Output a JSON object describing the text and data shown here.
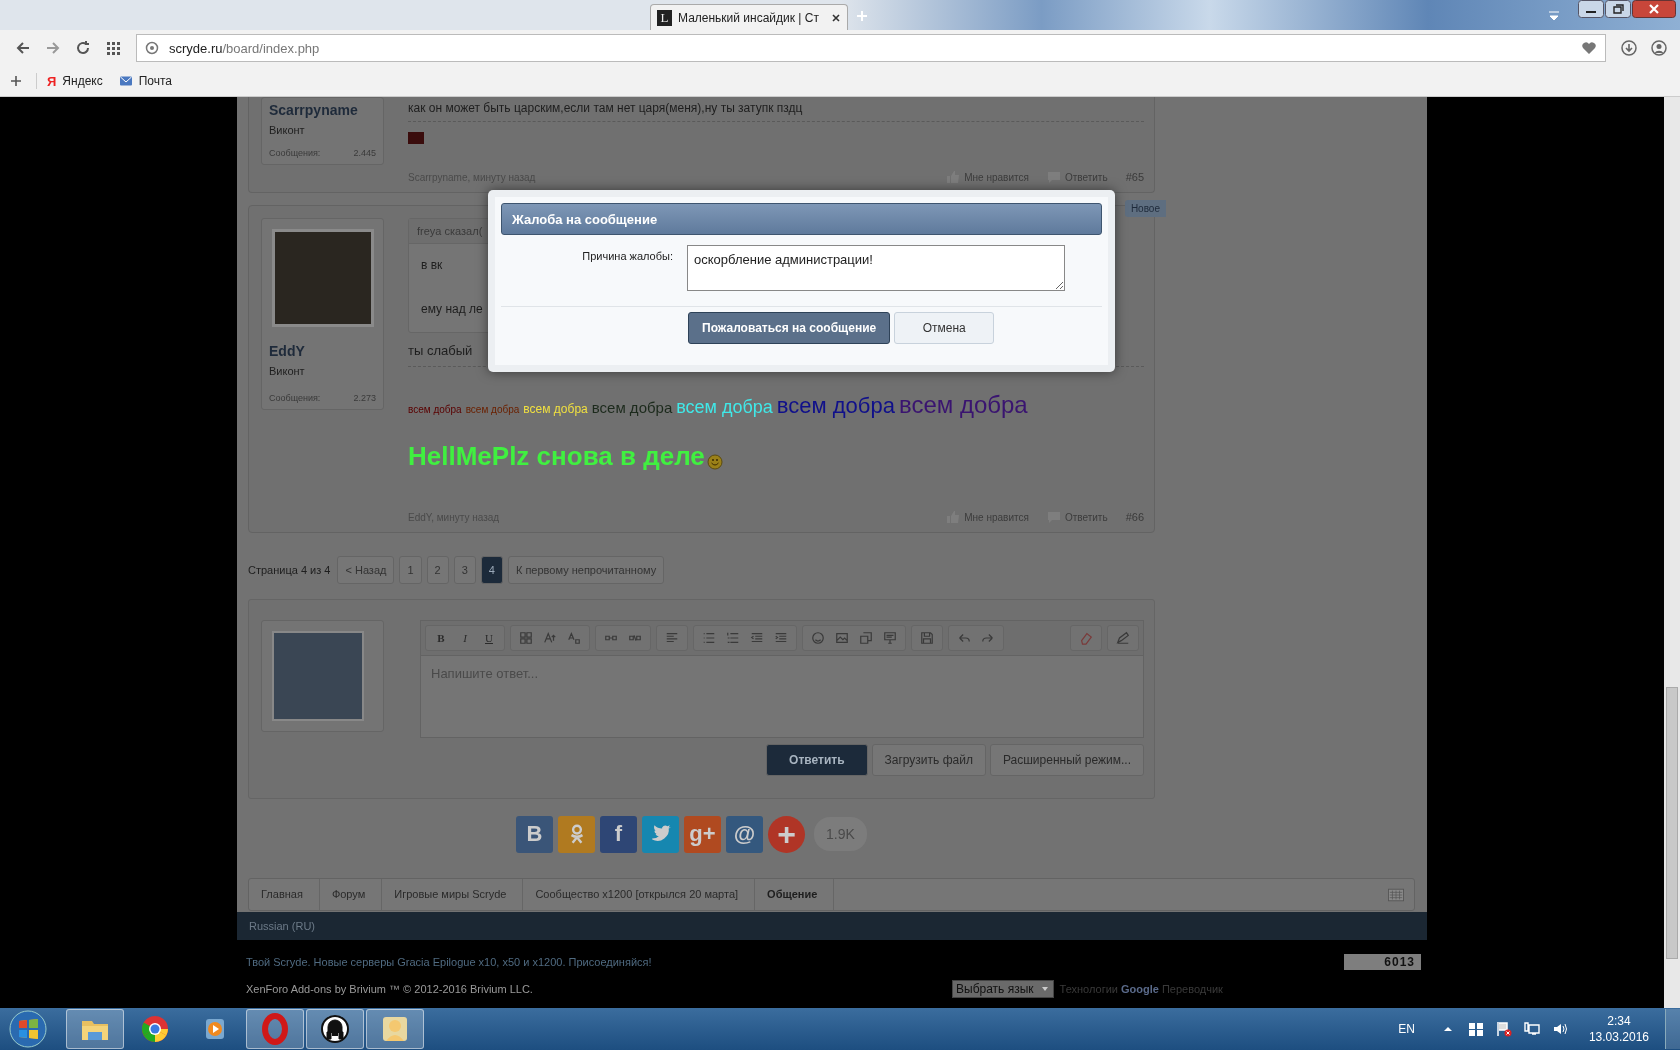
{
  "browser": {
    "tab": {
      "favicon": "L",
      "title": "Маленький инсайдик | Ст"
    },
    "address": {
      "domain": "scryde.ru",
      "path": "/board/index.php"
    },
    "bookmarks": [
      {
        "kind": "letter",
        "icon": "Я",
        "label": "Яндекс"
      },
      {
        "kind": "mail",
        "label": "Почта"
      }
    ]
  },
  "posts": [
    {
      "author": "Scarrpyname",
      "rank": "Виконт",
      "stat_label": "Сообщения:",
      "stat_value": "2.445",
      "has_avatar": false,
      "body": [
        {
          "kind": "text",
          "text": "как он может быть царским,если там нет царя(меня),ну ты затупк пздц"
        },
        {
          "kind": "rule"
        },
        {
          "kind": "image"
        }
      ],
      "byline": "Scarrpyname, минуту назад",
      "like": "Мне нравится",
      "reply": "Ответить",
      "number": "#65"
    },
    {
      "author": "EddY",
      "rank": "Виконт",
      "stat_label": "Сообщения:",
      "stat_value": "2.273",
      "has_avatar": true,
      "badge": "Новое",
      "body": [
        {
          "kind": "quote",
          "header": "freya сказал(",
          "lines": [
            "в вк",
            "ему над ле"
          ]
        },
        {
          "kind": "text",
          "text": "ты слабый"
        },
        {
          "kind": "rule"
        },
        {
          "kind": "rainbow",
          "words": [
            {
              "text": "всем добра",
              "color": "#5a0000"
            },
            {
              "text": "всем добра",
              "color": "#6a2000"
            },
            {
              "text": "всем добра",
              "color": "#f0e040"
            },
            {
              "text": "всем добра",
              "color": "#1c2a1c"
            },
            {
              "text": "всем добра",
              "color": "#40e8e8"
            },
            {
              "text": "всем добра",
              "color": "#10108a"
            },
            {
              "text": "всем добра",
              "color": "#3a1470"
            }
          ]
        },
        {
          "kind": "headline",
          "text": "HellMePlz снова в деле",
          "emoji": true
        }
      ],
      "byline": "EddY, минуту назад",
      "like": "Мне нравится",
      "reply": "Ответить",
      "number": "#66"
    }
  ],
  "pagination": {
    "label": "Страница 4 из 4",
    "prev": "< Назад",
    "pages": [
      {
        "label": "1",
        "selected": false
      },
      {
        "label": "2",
        "selected": false
      },
      {
        "label": "3",
        "selected": false
      },
      {
        "label": "4",
        "selected": true
      }
    ],
    "unread": "К первому непрочитанному"
  },
  "editor": {
    "format_buttons": [
      "B",
      "I",
      "U"
    ],
    "placeholder": "Напишите ответ...",
    "buttons": [
      {
        "label": "Ответить",
        "primary": true
      },
      {
        "label": "Загрузить файл",
        "primary": false
      },
      {
        "label": "Расширенный режим...",
        "primary": false
      }
    ]
  },
  "share": {
    "items": [
      {
        "kind": "glyph",
        "glyph": "В",
        "color": "#3a5578"
      },
      {
        "kind": "figure",
        "color": "#b07a20"
      },
      {
        "kind": "glyph",
        "glyph": "f",
        "color": "#2e4675"
      },
      {
        "kind": "bird",
        "color": "#1687b0"
      },
      {
        "kind": "glyph",
        "glyph": "g+",
        "color": "#b04a20"
      },
      {
        "kind": "glyph",
        "glyph": "@",
        "color": "#34587e"
      },
      {
        "kind": "round",
        "glyph": "+",
        "color": "#b03526"
      }
    ],
    "count": "1.9K"
  },
  "breadcrumb": [
    {
      "label": "Главная",
      "current": false
    },
    {
      "label": "Форум",
      "current": false
    },
    {
      "label": "Игровые миры Scryde",
      "current": false
    },
    {
      "label": "Сообщество x1200 [открылся 20 марта]",
      "current": false
    },
    {
      "label": "Общение",
      "current": true
    }
  ],
  "footer": {
    "language": "Russian (RU)",
    "promo": "Твой Scryde. Новые серверы Gracia Epilogue x10, x50 и x1200. Присоединяйся!",
    "counter": "6013",
    "copyright": "XenForo Add-ons by Brivium ™ © 2012-2016 Brivium LLC.",
    "translate_select": "Выбрать язык",
    "translate_note": "Технологии",
    "google": "Google",
    "translator": "Переводчик"
  },
  "dialog": {
    "title": "Жалоба на сообщение",
    "label": "Причина жалобы:",
    "value": "оскорбление администрации!",
    "submit": "Пожаловаться на сообщение",
    "cancel": "Отмена"
  },
  "taskbar": {
    "apps": [
      {
        "kind": "folder",
        "running": true
      },
      {
        "kind": "chrome",
        "running": false
      },
      {
        "kind": "player",
        "running": false
      },
      {
        "kind": "opera",
        "running": true
      },
      {
        "kind": "headphones",
        "running": true
      },
      {
        "kind": "portrait",
        "running": true
      }
    ],
    "language": "EN",
    "time": "2:34",
    "date": "13.03.2016"
  }
}
